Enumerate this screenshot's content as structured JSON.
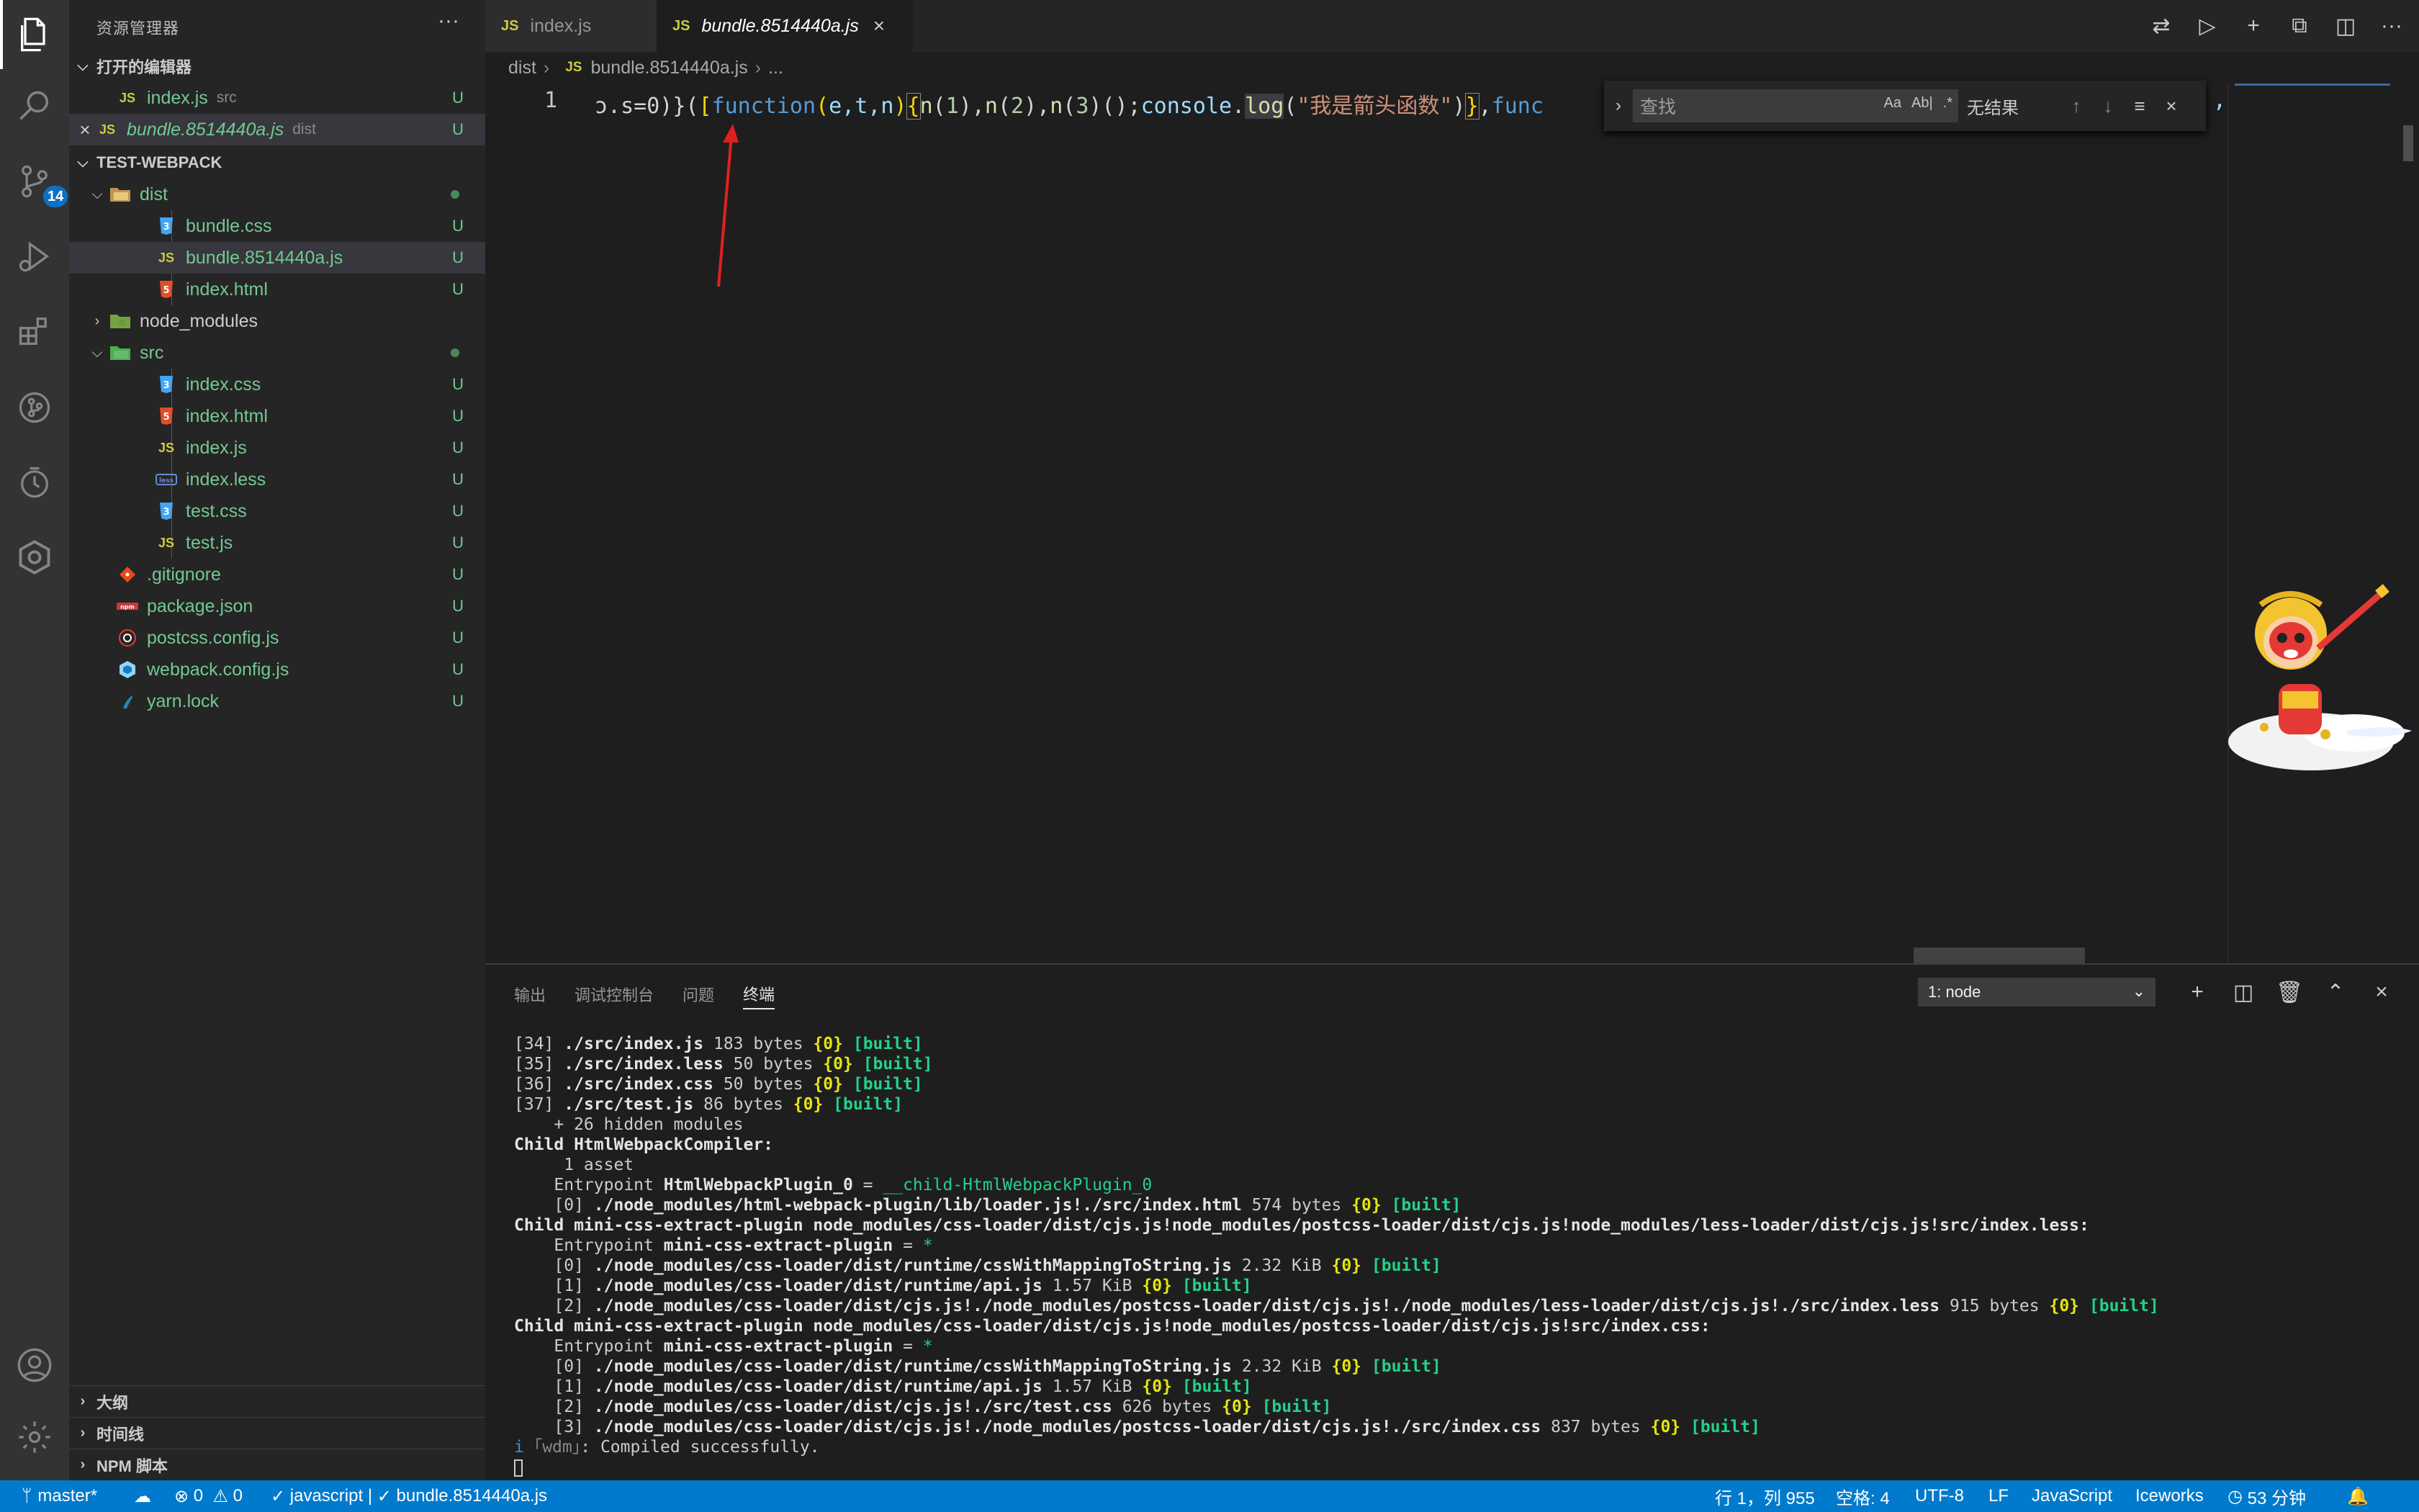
{
  "sidebar": {
    "title": "资源管理器",
    "open_editors_header": "打开的编辑器",
    "open_editors": [
      {
        "name": "index.js",
        "desc": "src",
        "status": "U"
      },
      {
        "name": "bundle.8514440a.js",
        "desc": "dist",
        "status": "U"
      }
    ],
    "project_header": "TEST-WEBPACK",
    "tree": {
      "dist": "dist",
      "bundle_css": "bundle.css",
      "bundle_js": "bundle.8514440a.js",
      "dist_index_html": "index.html",
      "node_modules": "node_modules",
      "src": "src",
      "src_index_css": "index.css",
      "src_index_html": "index.html",
      "src_index_js": "index.js",
      "src_index_less": "index.less",
      "src_test_css": "test.css",
      "src_test_js": "test.js",
      "gitignore": ".gitignore",
      "package_json": "package.json",
      "postcss_config": "postcss.config.js",
      "webpack_config": "webpack.config.js",
      "yarn_lock": "yarn.lock",
      "status_u": "U"
    },
    "outline": "大纲",
    "timeline": "时间线",
    "npm_scripts": "NPM 脚本"
  },
  "activity": {
    "scm_badge": "14"
  },
  "tabs": [
    {
      "label": "index.js",
      "icon": "JS"
    },
    {
      "label": "bundle.8514440a.js",
      "icon": "JS"
    }
  ],
  "breadcrumb": {
    "folder": "dist",
    "file": "bundle.8514440a.js",
    "more": "..."
  },
  "editor": {
    "line_number": "1",
    "code": {
      "p1": "ɔ.s=0)}(",
      "p2": "[",
      "p3": "function",
      "p4": "(",
      "p5": "e,t,n",
      "p6": ")",
      "p7": "{",
      "p8": "n",
      "p9": "(",
      "p10": "1",
      "p11": "),",
      "p12": "n",
      "p13": "(",
      "p14": "2",
      "p15": "),",
      "p16": "n",
      "p17": "(",
      "p18": "3",
      "p19": ")();",
      "p20": "console",
      "p21": ".",
      "p22": "log",
      "p23": "(",
      "p24": "\"我是箭头函数\"",
      "p25": ")",
      "p26": "}",
      "p27": ",",
      "p28": "func"
    },
    "tail": ",t"
  },
  "find": {
    "placeholder": "查找",
    "case": "Aa",
    "word": "Ab|",
    "regex": ".*",
    "result": "无结果"
  },
  "panel": {
    "tabs": [
      "输出",
      "调试控制台",
      "问题",
      "终端"
    ],
    "terminal_select": "1: node",
    "lines": [
      {
        "a": "[34] ",
        "b": "./src/index.js",
        "c": " 183 bytes ",
        "d": "{0}",
        "e": " [built]"
      },
      {
        "a": "[35] ",
        "b": "./src/index.less",
        "c": " 50 bytes ",
        "d": "{0}",
        "e": " [built]"
      },
      {
        "a": "[36] ",
        "b": "./src/index.css",
        "c": " 50 bytes ",
        "d": "{0}",
        "e": " [built]"
      },
      {
        "a": "[37] ",
        "b": "./src/test.js",
        "c": " 86 bytes ",
        "d": "{0}",
        "e": " [built]"
      }
    ],
    "hidden": "    + 26 hidden modules",
    "child1": "Child HtmlWebpackCompiler:",
    "asset": "     1 asset",
    "entry1_a": "    Entrypoint ",
    "entry1_b": "HtmlWebpackPlugin_0",
    "entry1_c": " = ",
    "entry1_d": "__child-HtmlWebpackPlugin_0",
    "l0_a": "    [0] ",
    "l0_b": "./node_modules/html-webpack-plugin/lib/loader.js!./src/index.html",
    "l0_c": " 574 bytes ",
    "l0_d": "{0}",
    "l0_e": " [built]",
    "child2": "Child mini-css-extract-plugin node_modules/css-loader/dist/cjs.js!node_modules/postcss-loader/dist/cjs.js!node_modules/less-loader/dist/cjs.js!src/index.less:",
    "entry2_a": "    Entrypoint ",
    "entry2_b": "mini-css-extract-plugin",
    "entry2_c": " = ",
    "entry2_d": "*",
    "c2": [
      {
        "a": "    [0] ",
        "b": "./node_modules/css-loader/dist/runtime/cssWithMappingToString.js",
        "c": " 2.32 KiB ",
        "d": "{0}",
        "e": " [built]"
      },
      {
        "a": "    [1] ",
        "b": "./node_modules/css-loader/dist/runtime/api.js",
        "c": " 1.57 KiB ",
        "d": "{0}",
        "e": " [built]"
      },
      {
        "a": "    [2] ",
        "b": "./node_modules/css-loader/dist/cjs.js!./node_modules/postcss-loader/dist/cjs.js!./node_modules/less-loader/dist/cjs.js!./src/index.less",
        "c": " 915 bytes ",
        "d": "{0}",
        "e": " [built]"
      }
    ],
    "child3": "Child mini-css-extract-plugin node_modules/css-loader/dist/cjs.js!node_modules/postcss-loader/dist/cjs.js!src/index.css:",
    "c3": [
      {
        "a": "    [0] ",
        "b": "./node_modules/css-loader/dist/runtime/cssWithMappingToString.js",
        "c": " 2.32 KiB ",
        "d": "{0}",
        "e": " [built]"
      },
      {
        "a": "    [1] ",
        "b": "./node_modules/css-loader/dist/runtime/api.js",
        "c": " 1.57 KiB ",
        "d": "{0}",
        "e": " [built]"
      },
      {
        "a": "    [2] ",
        "b": "./node_modules/css-loader/dist/cjs.js!./src/test.css",
        "c": " 626 bytes ",
        "d": "{0}",
        "e": " [built]"
      },
      {
        "a": "    [3] ",
        "b": "./node_modules/css-loader/dist/cjs.js!./node_modules/postcss-loader/dist/cjs.js!./src/index.css",
        "c": " 837 bytes ",
        "d": "{0}",
        "e": " [built]"
      }
    ],
    "wdm_i": "i",
    "wdm_tag": " ｢wdm｣",
    "wdm_msg": ": Compiled successfully."
  },
  "status": {
    "branch": "master*",
    "errors": "0",
    "warnings": "0",
    "check1": "javascript |",
    "check2": "bundle.8514440a.js",
    "position": "行 1，列 955",
    "spaces": "空格: 4",
    "encoding": "UTF-8",
    "eol": "LF",
    "language": "JavaScript",
    "iceworks": "Iceworks",
    "time": "53 分钟"
  },
  "colors": {
    "accent": "#007acc",
    "untracked": "#73c991",
    "js_icon": "#cbcb41"
  }
}
